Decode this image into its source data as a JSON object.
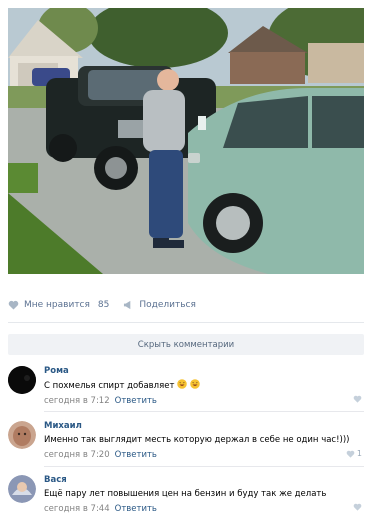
{
  "post": {
    "likes_label": "Мне нравится",
    "likes_count": "85",
    "share_label": "Поделиться"
  },
  "comments_section": {
    "hide_label": "Скрыть комментарии"
  },
  "comments": [
    {
      "author": "Рома",
      "text": "С похмелья спирт добавляет",
      "emoji": [
        "laughing-face",
        "laughing-face"
      ],
      "time": "сегодня в 7:12",
      "reply_label": "Ответить",
      "likes": ""
    },
    {
      "author": "Михаил",
      "text": "Именно так выглядит месть которую держал в себе не один час!)))",
      "time": "сегодня в 7:20",
      "reply_label": "Ответить",
      "likes": "1"
    },
    {
      "author": "Вася",
      "text": "Ещё пару лет повышения цен на бензин и буду так же делать",
      "time": "сегодня в 7:44",
      "reply_label": "Ответить",
      "likes": ""
    }
  ],
  "colors": {
    "link": "#2a5885",
    "meta": "#828282",
    "hide_bg": "#f0f2f5",
    "action": "#5b7191"
  }
}
